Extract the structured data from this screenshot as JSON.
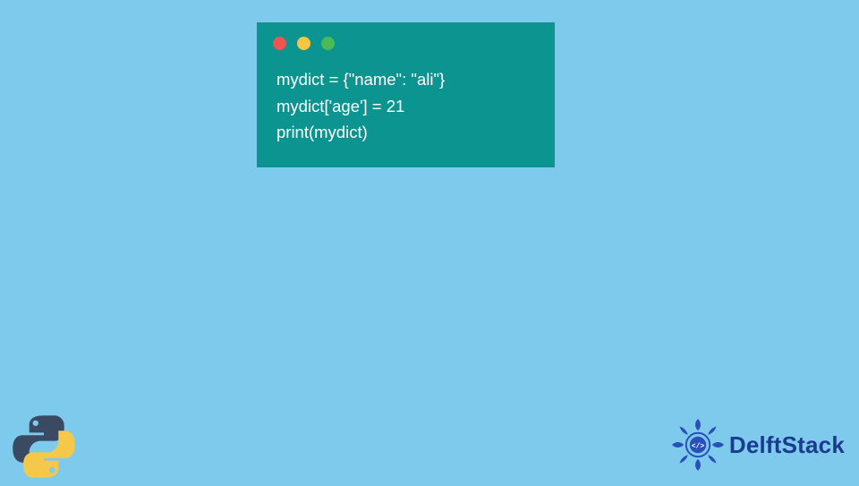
{
  "code": {
    "lines": [
      "mydict = {\"name\": \"ali\"}",
      "mydict['age'] = 21",
      "print(mydict)"
    ]
  },
  "dots": {
    "red": "#ef5451",
    "yellow": "#f6c743",
    "green": "#4abb52"
  },
  "brand": {
    "name": "DelftStack"
  },
  "colors": {
    "background": "#7ecaed",
    "window": "#0c9491",
    "code_text": "#ffffff",
    "brand_text": "#1a3b8f"
  }
}
